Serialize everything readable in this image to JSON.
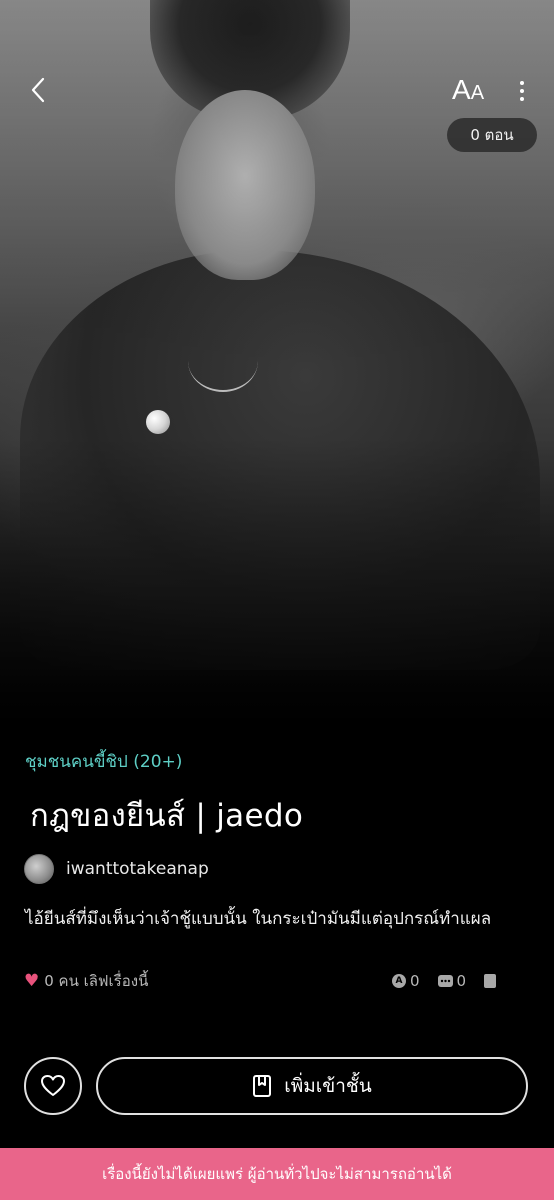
{
  "header": {
    "font_size_label_big": "A",
    "font_size_label_small": "A",
    "episode_count": "0 ตอน"
  },
  "story": {
    "category": "ชุมชนคนขี้ชิป (20+)",
    "title": "กฎของยีนส์ | jaedo",
    "author": "iwanttotakeanap",
    "synopsis": "ไอ้ยีนส์ที่มึงเห็นว่าเจ้าชู้แบบนั้น ในกระเป๋ามันมีแต่อุปกรณ์ทำแผล"
  },
  "stats": {
    "likes_text": "0 คน เลิฟเรื่องนี้",
    "comment_count": "0",
    "bubble_count": "0",
    "icon_a_letter": "A"
  },
  "actions": {
    "add_to_shelf_label": "เพิ่มเข้าชั้น"
  },
  "banner": {
    "text": "เรื่องนี้ยังไม่ได้เผยแพร่ ผู้อ่านทั่วไปจะไม่สามารถอ่านได้"
  },
  "colors": {
    "category": "#5ecfc6",
    "heart": "#e8527c",
    "banner": "#e9658a"
  }
}
